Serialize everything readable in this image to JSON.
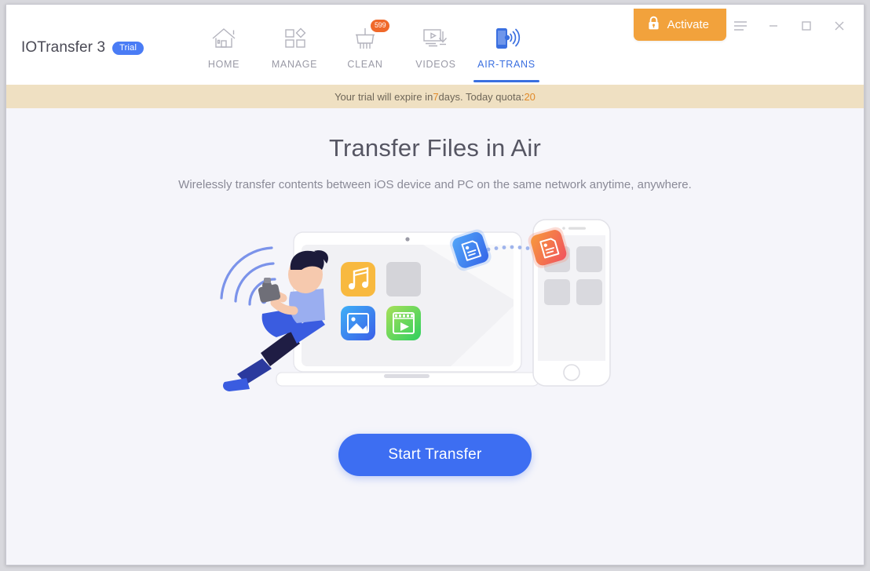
{
  "app": {
    "name": "IOTransfer 3",
    "trial_badge": "Trial"
  },
  "nav": {
    "items": [
      {
        "label": "HOME",
        "icon": "home-icon",
        "active": false,
        "badge": null
      },
      {
        "label": "MANAGE",
        "icon": "manage-icon",
        "active": false,
        "badge": null
      },
      {
        "label": "CLEAN",
        "icon": "clean-icon",
        "active": false,
        "badge": "599"
      },
      {
        "label": "VIDEOS",
        "icon": "videos-icon",
        "active": false,
        "badge": null
      },
      {
        "label": "AIR-TRANS",
        "icon": "air-trans-icon",
        "active": true,
        "badge": null
      }
    ]
  },
  "titlebar": {
    "activate_label": "Activate",
    "activate_icon": "lock-icon",
    "activate_color": "#f2a23c",
    "menu_icon": "hamburger-menu-icon",
    "minimize_icon": "minimize-icon",
    "maximize_icon": "maximize-icon",
    "close_icon": "close-icon"
  },
  "banner": {
    "text_before": "Your trial will expire in ",
    "days": "7",
    "text_middle": " days. Today quota: ",
    "quota": "20",
    "background": "#efe0c2",
    "highlight_color": "#e08a2a"
  },
  "main": {
    "title": "Transfer Files in Air",
    "subtitle": "Wirelessly transfer contents between iOS device and PC on the same network anytime, anywhere.",
    "start_button": "Start Transfer",
    "accent_color": "#3d6ef2",
    "background": "#f5f5fa"
  },
  "illustration": {
    "name": "air-transfer-illustration",
    "laptop_icons": [
      {
        "name": "music-icon",
        "color": "#f8b93f"
      },
      {
        "name": "placeholder-tile",
        "color": "#d4d4d9"
      },
      {
        "name": "photo-icon",
        "color": "#3d9bf5"
      },
      {
        "name": "video-icon",
        "color": "#5ed15e"
      }
    ],
    "flying_files": [
      {
        "name": "document-card-blue",
        "color": "#3d8ef2"
      },
      {
        "name": "document-card-orange",
        "color": "#f26a4b"
      }
    ],
    "person": {
      "name": "person-with-camera",
      "hair": "#1c1b3a",
      "shirt": "#9aaef0",
      "pants": "#3a5ce0"
    },
    "wifi_waves": {
      "name": "wifi-waves-icon",
      "color": "#6b86e8"
    },
    "phone": {
      "name": "iphone-mockup",
      "outline": "#e2e2e8"
    }
  }
}
